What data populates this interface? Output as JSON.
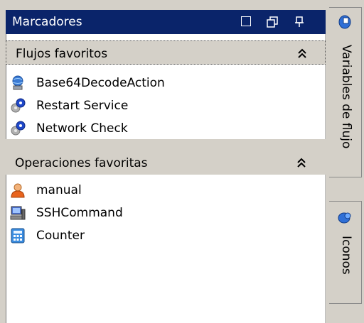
{
  "window": {
    "title": "Marcadores",
    "controls": [
      "maximize-icon",
      "restore-icon",
      "pin-icon"
    ]
  },
  "sections": [
    {
      "title": "Flujos favoritos",
      "items": [
        {
          "label": "Base64DecodeAction",
          "icon": "globe-computer-icon"
        },
        {
          "label": "Restart Service",
          "icon": "gears-icon"
        },
        {
          "label": "Network Check",
          "icon": "gears-icon"
        }
      ]
    },
    {
      "title": "Operaciones favoritas",
      "items": [
        {
          "label": "manual",
          "icon": "user-icon"
        },
        {
          "label": "SSHCommand",
          "icon": "terminal-computer-icon"
        },
        {
          "label": "Counter",
          "icon": "calculator-icon"
        }
      ]
    }
  ],
  "side_tabs": [
    {
      "label": "Variables de flujo",
      "icon": "flow-variables-icon"
    },
    {
      "label": "Iconos",
      "icon": "icons-icon"
    }
  ],
  "colors": {
    "titlebar": "#0a246a",
    "header_bg": "#d4d0c8"
  }
}
